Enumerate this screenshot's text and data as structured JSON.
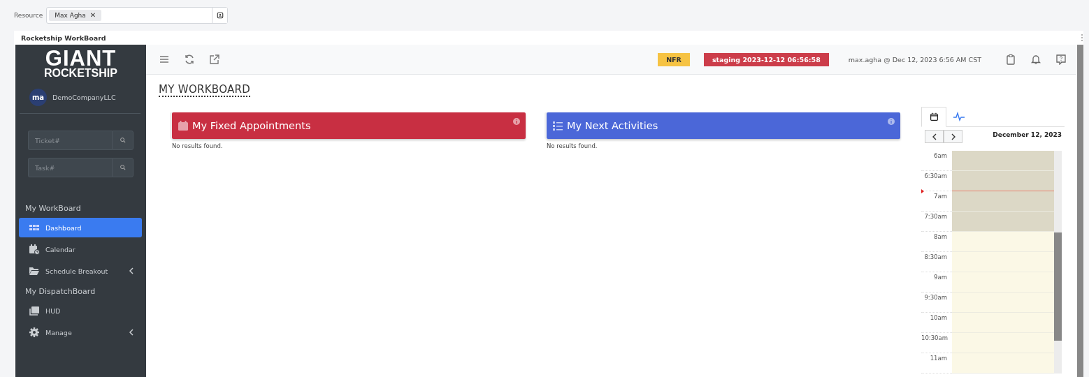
{
  "resource_filter": {
    "label": "Resource",
    "chips": [
      {
        "label": "Max Agha",
        "remove": "✕"
      }
    ]
  },
  "window": {
    "title": "Rocketship WorkBoard"
  },
  "sidebar": {
    "logo": {
      "line_1": "GIANT",
      "line_2": "ROCKETSHIP"
    },
    "account": {
      "avatar": "ma",
      "name": "DemoCompanyLLC"
    },
    "searches": [
      {
        "placeholder": "Ticket#"
      },
      {
        "placeholder": "Task#"
      }
    ],
    "sections": [
      {
        "heading": "My WorkBoard",
        "items": [
          {
            "label": "Dashboard",
            "selected": true,
            "expandable": false
          },
          {
            "label": "Calendar",
            "selected": false,
            "expandable": false
          },
          {
            "label": "Schedule Breakout",
            "selected": false,
            "expandable": true
          }
        ]
      },
      {
        "heading": "My DispatchBoard",
        "items": [
          {
            "label": "HUD",
            "selected": false,
            "expandable": false
          },
          {
            "label": "Manage",
            "selected": false,
            "expandable": true
          }
        ]
      }
    ]
  },
  "topbar": {
    "badges": [
      {
        "label": "NFR",
        "color": "#f6c343"
      },
      {
        "label": "staging 2023-12-12 06:56:58",
        "color": "#cc3d4a"
      }
    ],
    "user": "max.agha @ Dec 12, 2023 6:56 AM CST"
  },
  "page_title": "MY WORKBOARD",
  "panels": [
    {
      "title": "My Fixed Appointments",
      "color": "#c82f42",
      "empty_text": "No results found."
    },
    {
      "title": "My Next Activities",
      "color": "#4b67d8",
      "empty_text": "No results found."
    }
  ],
  "calendar": {
    "tabs": [
      {
        "selected": true
      },
      {
        "selected": false
      }
    ],
    "date": "December 12, 2023",
    "slots": [
      {
        "label": "6am",
        "business": false,
        "now": false
      },
      {
        "label": "6:30am",
        "business": false,
        "now": true
      },
      {
        "label": "7am",
        "business": false,
        "now": false
      },
      {
        "label": "7:30am",
        "business": false,
        "now": false
      },
      {
        "label": "8am",
        "business": true,
        "now": false
      },
      {
        "label": "8:30am",
        "business": true,
        "now": false
      },
      {
        "label": "9am",
        "business": true,
        "now": false
      },
      {
        "label": "9:30am",
        "business": true,
        "now": false
      },
      {
        "label": "10am",
        "business": true,
        "now": false
      },
      {
        "label": "10:30am",
        "business": true,
        "now": false
      },
      {
        "label": "11am",
        "business": true,
        "now": false
      }
    ]
  }
}
